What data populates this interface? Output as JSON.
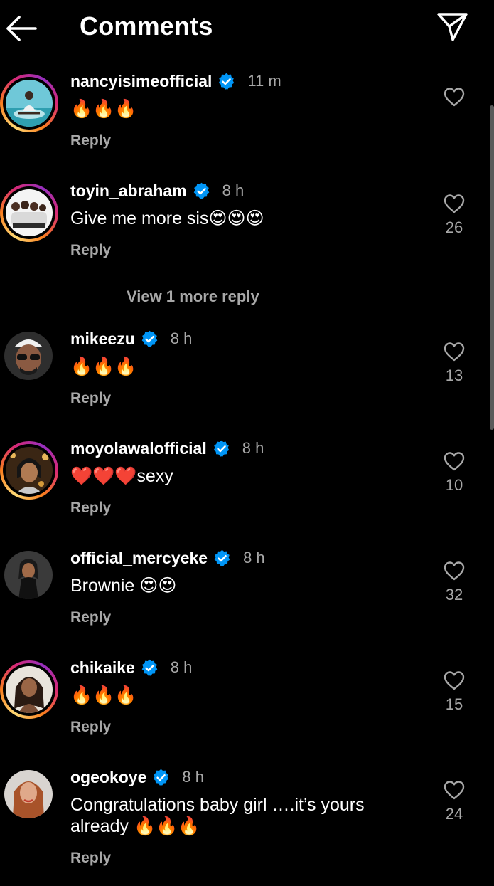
{
  "header": {
    "title": "Comments",
    "back_icon": "arrow-left-icon",
    "share_icon": "paper-plane-icon"
  },
  "view_more_replies": "View 1 more reply",
  "colors": {
    "background": "#000000",
    "secondary_text": "#a8a8a8",
    "verified": "#0095f6"
  },
  "comments": [
    {
      "username": "nancyisimeofficial",
      "time": "11 m",
      "text": "🔥🔥🔥",
      "reply_label": "Reply",
      "likes": "",
      "verified": true,
      "story_ring": true
    },
    {
      "username": "toyin_abraham",
      "time": "8 h",
      "text": "Give me more sis😍😍😍",
      "reply_label": "Reply",
      "likes": "26",
      "verified": true,
      "story_ring": true
    },
    {
      "username": "mikeezu",
      "time": "8 h",
      "text": "🔥🔥🔥",
      "reply_label": "Reply",
      "likes": "13",
      "verified": true,
      "story_ring": false
    },
    {
      "username": "moyolawalofficial",
      "time": "8 h",
      "text": "❤️❤️❤️sexy",
      "reply_label": "Reply",
      "likes": "10",
      "verified": true,
      "story_ring": true
    },
    {
      "username": "official_mercyeke",
      "time": "8 h",
      "text": "Brownie 😍😍",
      "reply_label": "Reply",
      "likes": "32",
      "verified": true,
      "story_ring": false
    },
    {
      "username": "chikaike",
      "time": "8 h",
      "text": "🔥🔥🔥",
      "reply_label": "Reply",
      "likes": "15",
      "verified": true,
      "story_ring": true
    },
    {
      "username": "ogeokoye",
      "time": "8 h",
      "text": "Congratulations baby girl ….it’s yours already 🔥🔥🔥",
      "reply_label": "Reply",
      "likes": "24",
      "verified": true,
      "story_ring": false
    }
  ]
}
